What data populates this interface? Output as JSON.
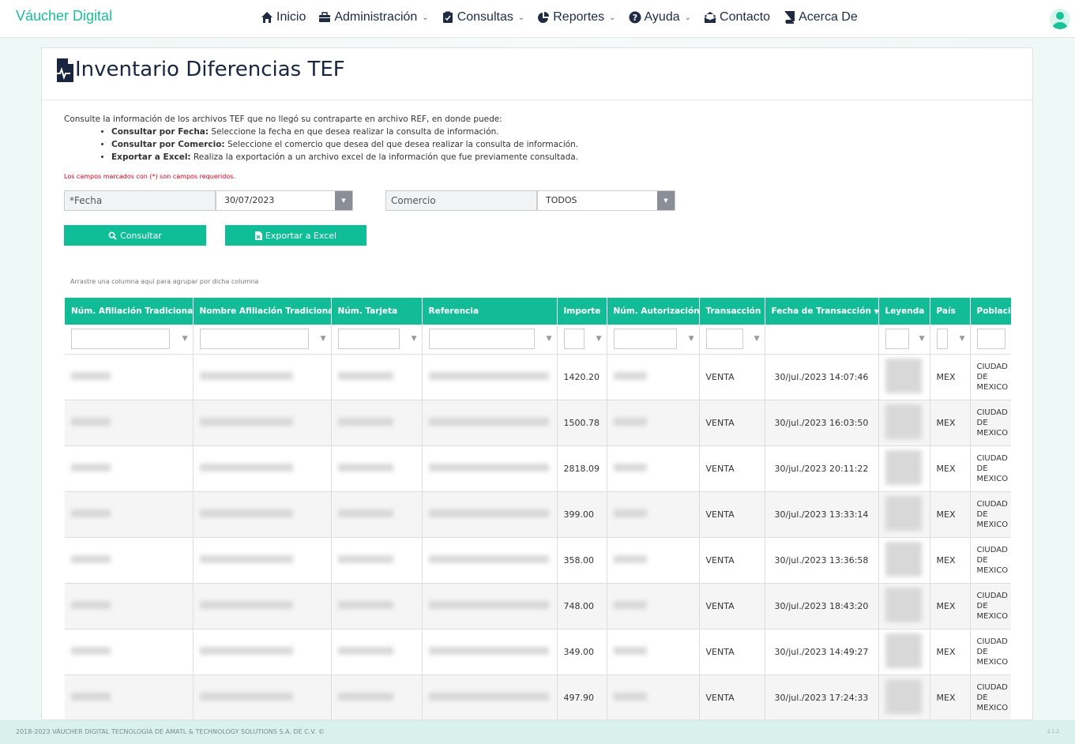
{
  "brand": "Váucher Digital",
  "nav": [
    {
      "label": "Inicio",
      "icon": "home-icon",
      "caret": false
    },
    {
      "label": "Administración",
      "icon": "briefcase-icon",
      "caret": true
    },
    {
      "label": "Consultas",
      "icon": "clipboard-check-icon",
      "caret": true
    },
    {
      "label": "Reportes",
      "icon": "pie-chart-icon",
      "caret": true
    },
    {
      "label": "Ayuda",
      "icon": "question-circle-icon",
      "caret": true
    },
    {
      "label": "Contacto",
      "icon": "envelope-open-icon",
      "caret": false
    },
    {
      "label": "Acerca De",
      "icon": "book-icon",
      "caret": false
    }
  ],
  "page": {
    "title": "Inventario Diferencias TEF",
    "intro": "Consulte la información de los archivos TEF que no llegó su contraparte en archivo REF, en donde puede:",
    "bullets": [
      {
        "bold": "Consultar por Fecha:",
        "text": " Seleccione la fecha en que desea realizar la consulta de información."
      },
      {
        "bold": "Consultar por Comercio:",
        "text": " Seleccione el comercio que desea del que desea realizar la consulta de información."
      },
      {
        "bold": "Exportar a Excel:",
        "text": " Realiza la exportación a un archivo excel de la información que fue previamente consultada."
      }
    ],
    "required_note": "Los campos marcados con (*) son campos requeridos."
  },
  "form": {
    "fecha_label": "*Fecha",
    "fecha_value": "30/07/2023",
    "comercio_label": "Comercio",
    "comercio_value": "TODOS",
    "consultar_label": "Consultar",
    "exportar_label": "Exportar a Excel"
  },
  "grid": {
    "group_hint": "Arrastre una columna aquí para agrupar por dicha columna",
    "columns": [
      "Núm. Afiliación Tradicional",
      "Nombre Afiliación Tradicional",
      "Núm. Tarjeta",
      "Referencia",
      "Importe",
      "Núm. Autorización",
      "Transacción",
      "Fecha de Transacción",
      "Leyenda",
      "País",
      "Población"
    ],
    "rows": [
      {
        "importe": "1420.20",
        "transaccion": "VENTA",
        "fecha": "30/jul./2023 14:07:46",
        "pais": "MEX",
        "poblacion": "CIUDAD DE MEXICO"
      },
      {
        "importe": "1500.78",
        "transaccion": "VENTA",
        "fecha": "30/jul./2023 16:03:50",
        "pais": "MEX",
        "poblacion": "CIUDAD DE MEXICO"
      },
      {
        "importe": "2818.09",
        "transaccion": "VENTA",
        "fecha": "30/jul./2023 20:11:22",
        "pais": "MEX",
        "poblacion": "CIUDAD DE MEXICO"
      },
      {
        "importe": "399.00",
        "transaccion": "VENTA",
        "fecha": "30/jul./2023 13:33:14",
        "pais": "MEX",
        "poblacion": "CIUDAD DE MEXICO"
      },
      {
        "importe": "358.00",
        "transaccion": "VENTA",
        "fecha": "30/jul./2023 13:36:58",
        "pais": "MEX",
        "poblacion": "CIUDAD DE MEXICO"
      },
      {
        "importe": "748.00",
        "transaccion": "VENTA",
        "fecha": "30/jul./2023 18:43:20",
        "pais": "MEX",
        "poblacion": "CIUDAD DE MEXICO"
      },
      {
        "importe": "349.00",
        "transaccion": "VENTA",
        "fecha": "30/jul./2023 14:49:27",
        "pais": "MEX",
        "poblacion": "CIUDAD DE MEXICO"
      },
      {
        "importe": "497.90",
        "transaccion": "VENTA",
        "fecha": "30/jul./2023 17:24:33",
        "pais": "MEX",
        "poblacion": "CIUDAD DE MEXICO"
      }
    ]
  },
  "footer": {
    "copyright": "2018-2023 VÁUCHER DIGITAL TECNOLOGÍA DE AMATL & TECHNOLOGY SOLUTIONS S.A. DE C.V. ©",
    "version": "2.1.2"
  },
  "colors": {
    "accent": "#12bc97",
    "brand": "#1bbd9c",
    "title": "#1a2540"
  }
}
